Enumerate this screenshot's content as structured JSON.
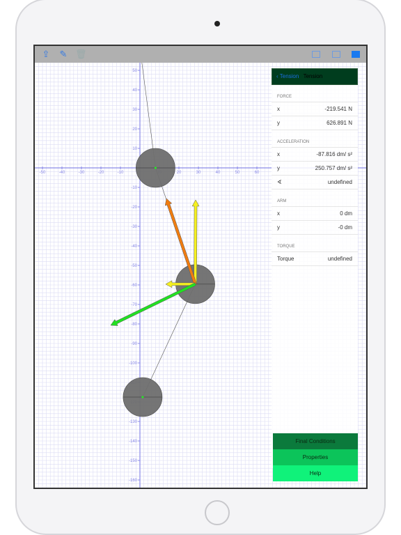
{
  "toolbar": {
    "left_icons": [
      "share-icon",
      "compose-icon",
      "trash-icon"
    ],
    "right_icons": [
      "sidebar-left-icon",
      "panel-icon",
      "sidebar-right-icon"
    ]
  },
  "panel": {
    "back_label": "Tension",
    "title": "Tension",
    "sections": [
      {
        "header": "FORCE",
        "rows": [
          {
            "label": "x",
            "value": "-219.541 N"
          },
          {
            "label": "y",
            "value": "626.891 N"
          }
        ]
      },
      {
        "header": "ACCELERATION",
        "rows": [
          {
            "label": "x",
            "value": "-87.816 dm/ s²"
          },
          {
            "label": "y",
            "value": "250.757 dm/ s²"
          },
          {
            "label": "∢",
            "value": "undefined"
          }
        ]
      },
      {
        "header": "ARM",
        "rows": [
          {
            "label": "x",
            "value": "0 dm"
          },
          {
            "label": "y",
            "value": "-0 dm"
          }
        ]
      },
      {
        "header": "TORQUE",
        "rows": [
          {
            "label": "Torque",
            "value": "undefined"
          }
        ]
      }
    ]
  },
  "buttons": [
    {
      "label": "Final Conditions",
      "color": "#0b7a3c"
    },
    {
      "label": "Properties",
      "color": "#0cc45a"
    },
    {
      "label": "Help",
      "color": "#10f27a"
    }
  ],
  "plot": {
    "x_ticks": [
      -50,
      -40,
      -30,
      -20,
      -10,
      10,
      20,
      30,
      40,
      50,
      60
    ],
    "y_ticks": [
      50,
      40,
      30,
      20,
      10,
      -10,
      -20,
      -30,
      -40,
      -50,
      -60,
      -70,
      -80,
      -90,
      -100,
      -110,
      -120,
      -130,
      -140,
      -150,
      -160
    ],
    "grid_step": 2,
    "colors": {
      "grid": "#dcdcf4",
      "axis": "#8a8ae8",
      "ball": "#6e6e6e"
    },
    "rope": [
      [
        1,
        54
      ],
      [
        8,
        0
      ],
      [
        28.4,
        -59.6
      ],
      [
        1.4,
        -117.5
      ]
    ],
    "balls": [
      {
        "x": 8,
        "y": 0,
        "r": 10
      },
      {
        "x": 28.4,
        "y": -59.6,
        "r": 10
      },
      {
        "x": 1.4,
        "y": -117.5,
        "r": 10
      }
    ],
    "vectors": [
      {
        "from": [
          28.4,
          -59.6
        ],
        "to": [
          28.6,
          -16.4
        ],
        "color": "#f5f020"
      },
      {
        "from": [
          28.4,
          -59.6
        ],
        "to": [
          13.6,
          -15.7
        ],
        "color": "#f07c10"
      },
      {
        "from": [
          28.4,
          -59.6
        ],
        "to": [
          13.2,
          -59.6
        ],
        "color": "#f5f020"
      },
      {
        "from": [
          28.4,
          -59.6
        ],
        "to": [
          -15,
          -80.7
        ],
        "color": "#22e022"
      }
    ]
  }
}
